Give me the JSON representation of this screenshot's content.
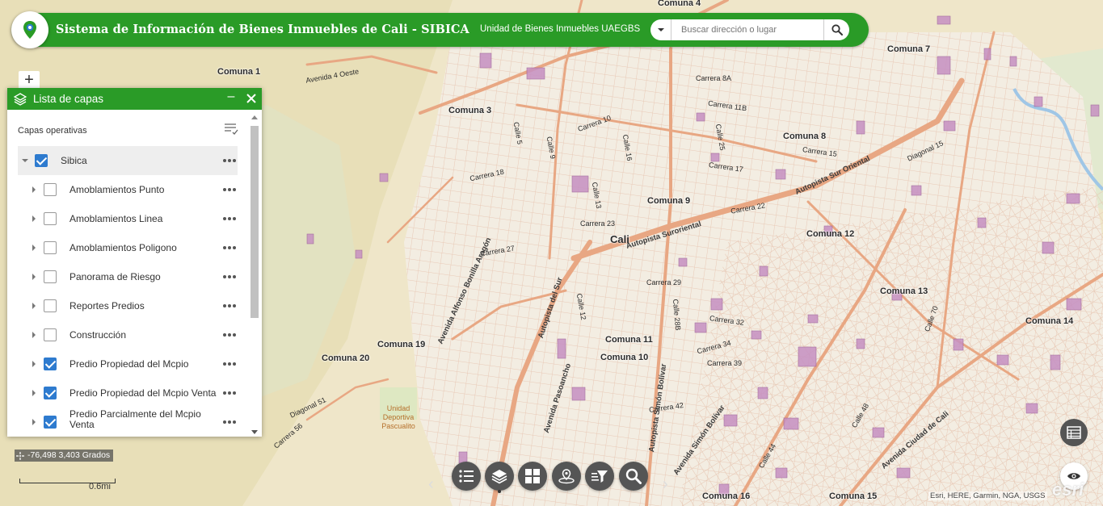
{
  "header": {
    "title": "Sistema de Información de Bienes Inmuebles de Cali - SIBICA",
    "subtitle": "Unidad de Bienes Inmuebles UAEGBS",
    "search_placeholder": "Buscar dirección o lugar",
    "logo_icon": "map-pin-icon",
    "colors": {
      "brand": "#2a9b27",
      "checkbox": "#2e7bcf"
    }
  },
  "zoom": {
    "in_label": "+"
  },
  "layer_panel": {
    "title": "Lista de capas",
    "minimize_label": "–",
    "section_label": "Capas operativas",
    "root": {
      "label": "Sibica",
      "checked": true,
      "expanded": true
    },
    "layers": [
      {
        "label": "Amoblamientos Punto",
        "checked": false
      },
      {
        "label": "Amoblamientos Linea",
        "checked": false
      },
      {
        "label": "Amoblamientos Poligono",
        "checked": false
      },
      {
        "label": "Panorama de Riesgo",
        "checked": false
      },
      {
        "label": "Reportes Predios",
        "checked": false
      },
      {
        "label": "Construcción",
        "checked": false
      },
      {
        "label": "Predio Propiedad del Mcpio",
        "checked": true
      },
      {
        "label": "Predio Propiedad del Mcpio Venta",
        "checked": true
      },
      {
        "label": "Predio Parcialmente del Mcpio Venta",
        "checked": true
      }
    ]
  },
  "coords": {
    "text": "-76,498 3,403 Grados"
  },
  "scale": {
    "label": "0.6mi"
  },
  "toolbar": {
    "buttons": [
      "list-icon",
      "layers-icon",
      "basemap-grid-icon",
      "location-icon",
      "filter-icon",
      "search-icon"
    ],
    "prev": "‹",
    "next": "›"
  },
  "attribution": "Esri, HERE, Garmin, NGA, USGS",
  "esri_logo": "esri",
  "map": {
    "city": "Cali",
    "comunas": [
      "Comuna 1",
      "Comuna 3",
      "Comuna 4",
      "Comuna 7",
      "Comuna 8",
      "Comuna 9",
      "Comuna 10",
      "Comuna 11",
      "Comuna 12",
      "Comuna 13",
      "Comuna 14",
      "Comuna 15",
      "Comuna 16",
      "Comuna 19",
      "Comuna 20"
    ],
    "park": "Unidad Deportiva Pascualito",
    "streets": [
      "Carrera 8A",
      "Carrera 10",
      "Carrera 11B",
      "Carrera 15",
      "Carrera 17",
      "Carrera 18",
      "Carrera 22",
      "Carrera 23",
      "Carrera 27",
      "Carrera 29",
      "Carrera 32",
      "Carrera 34",
      "Carrera 39",
      "Carrera 42",
      "Calle 5",
      "Calle 9",
      "Calle 12",
      "Calle 13",
      "Calle 16",
      "Calle 25",
      "Calle 28B",
      "Calle 44",
      "Calle 48",
      "Calle 70",
      "Diagonal 15",
      "Diagonal 51",
      "Autopista Suroriental",
      "Autopista Sur Oriental",
      "Autopista del Sur",
      "Autopista Simón Bolívar",
      "Avenida Simón Bolívar",
      "Avenida Ciudad de Cali",
      "Avenida Alfonso Bonilla Aragón",
      "Avenida Pasoancho",
      "Avenida 4 Oeste",
      "Carrera 56"
    ]
  }
}
